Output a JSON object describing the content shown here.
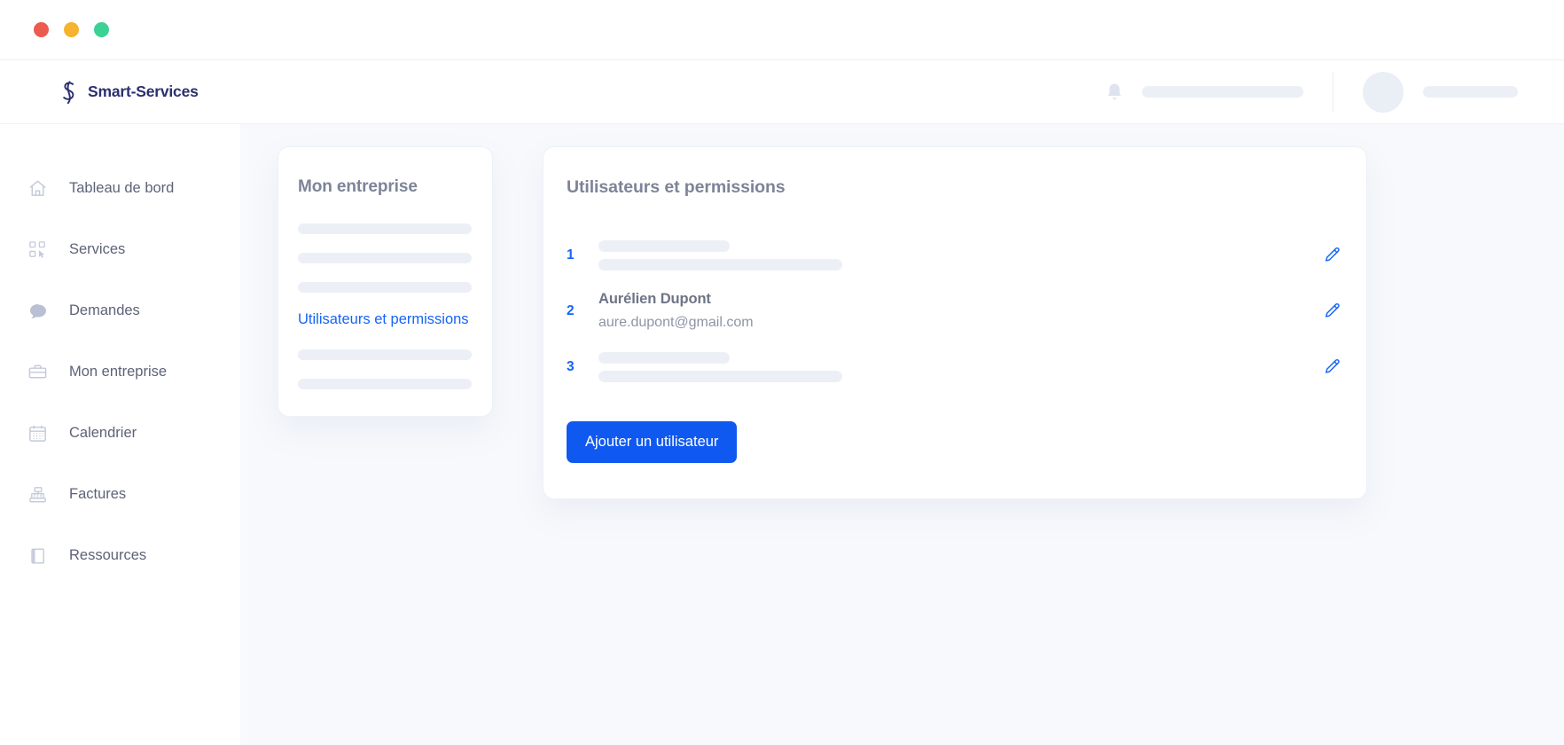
{
  "window": {
    "traffic_lights": [
      {
        "name": "close",
        "color": "#ED5B4E"
      },
      {
        "name": "minimize",
        "color": "#F5B32E"
      },
      {
        "name": "zoom",
        "color": "#3CD295"
      }
    ]
  },
  "brand": {
    "name": "Smart-Services",
    "logo_icon": "s-monogram-icon",
    "color": "#2c2f6e"
  },
  "header": {
    "bell_icon": "notification-bell-icon",
    "notification_placeholder": "",
    "avatar_icon": "avatar-placeholder",
    "username_placeholder": ""
  },
  "sidebar": {
    "items": [
      {
        "label": "Tableau de bord",
        "icon": "home-icon"
      },
      {
        "label": "Services",
        "icon": "grid-cursor-icon"
      },
      {
        "label": "Demandes",
        "icon": "speech-bubble-icon"
      },
      {
        "label": "Mon entreprise",
        "icon": "briefcase-icon"
      },
      {
        "label": "Calendrier",
        "icon": "calendar-icon"
      },
      {
        "label": "Factures",
        "icon": "cash-register-icon"
      },
      {
        "label": "Ressources",
        "icon": "book-icon"
      }
    ]
  },
  "subnav_card": {
    "title": "Mon entreprise",
    "skeleton_widths_top": [
      "100%",
      "100%",
      "100%"
    ],
    "active_link": "Utilisateurs et permissions",
    "skeleton_widths_bottom": [
      "100%",
      "100%"
    ],
    "link_color": "#1765f5"
  },
  "users_panel": {
    "title": "Utilisateurs et permissions",
    "rows": [
      {
        "index": "1",
        "loading": true,
        "name": "",
        "email": "",
        "edit_icon": "pencil-edit-icon"
      },
      {
        "index": "2",
        "loading": false,
        "name": "Aurélien Dupont",
        "email": "aure.dupont@gmail.com",
        "edit_icon": "pencil-edit-icon"
      },
      {
        "index": "3",
        "loading": true,
        "name": "",
        "email": "",
        "edit_icon": "pencil-edit-icon"
      }
    ],
    "add_button_label": "Ajouter un utilisateur",
    "accent_color": "#1059f0"
  }
}
